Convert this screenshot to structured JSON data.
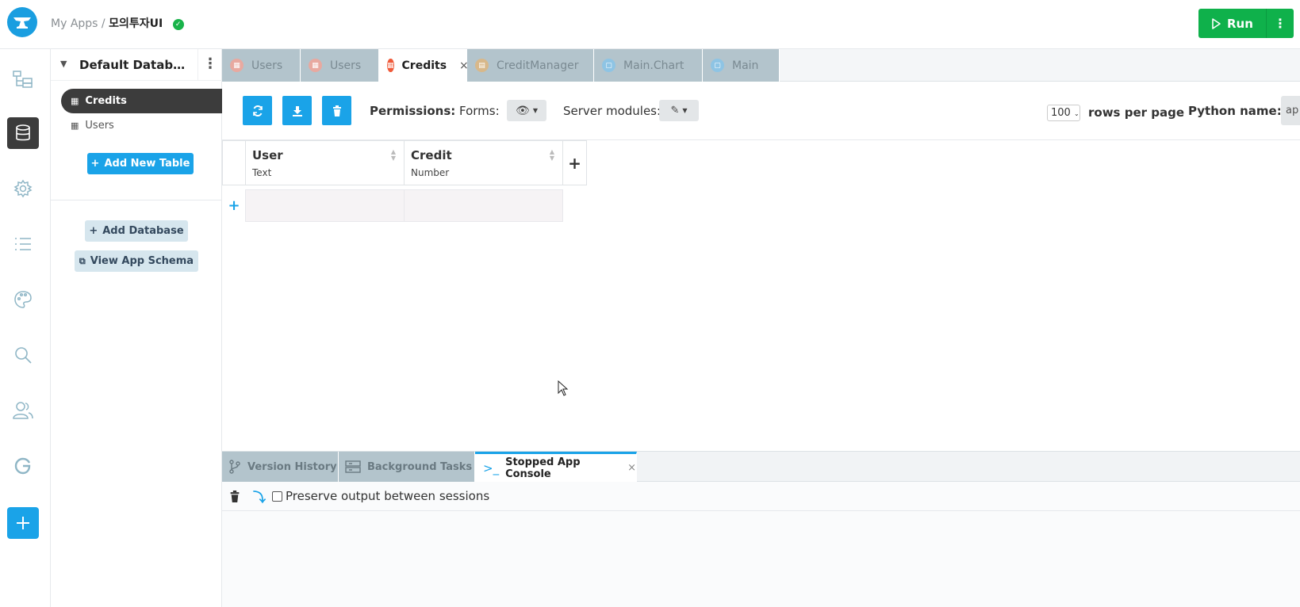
{
  "header": {
    "crumb_root": "My Apps /",
    "app_name": "모의투자UI",
    "run_label": "Run",
    "run_more": "⋮"
  },
  "rail": {
    "items": [
      "app-browser-icon",
      "database-icon",
      "settings-icon",
      "list-icon",
      "palette-icon",
      "search-icon",
      "users-icon",
      "google-icon",
      "add-icon"
    ],
    "active": "database-icon"
  },
  "db_panel": {
    "title": "Default Database...",
    "tables": [
      {
        "label": "Credits",
        "active": true
      },
      {
        "label": "Users",
        "active": false
      }
    ],
    "add_table_label": "Add New Table",
    "add_db_label": "Add Database",
    "schema_label": "View App Schema"
  },
  "tabs": [
    {
      "label": "Users",
      "kind": "table",
      "active": false
    },
    {
      "label": "Users",
      "kind": "table",
      "active": false
    },
    {
      "label": "Credits",
      "kind": "table",
      "active": true
    },
    {
      "label": "CreditManager",
      "kind": "module",
      "active": false
    },
    {
      "label": "Main.Chart",
      "kind": "form",
      "active": false
    },
    {
      "label": "Main",
      "kind": "form",
      "active": false
    }
  ],
  "toolbar": {
    "permissions_label": "Permissions:",
    "forms_label": "Forms:",
    "server_modules_label": "Server modules:",
    "rows_per_page_value": "100",
    "rows_per_page_label": "rows per page",
    "python_name_label": "Python name:",
    "python_name_value": "ap"
  },
  "grid": {
    "columns": [
      {
        "name": "User",
        "type": "Text"
      },
      {
        "name": "Credit",
        "type": "Number"
      }
    ]
  },
  "bottom": {
    "tabs": [
      {
        "label": "Version History",
        "active": false
      },
      {
        "label": "Background Tasks",
        "active": false
      },
      {
        "label": "Stopped App Console",
        "active": true
      }
    ],
    "preserve_label": "Preserve output between sessions"
  },
  "colors": {
    "accent": "#1aa3e8",
    "run": "#0fb14b",
    "tab_inactive": "#b3c4cc"
  }
}
